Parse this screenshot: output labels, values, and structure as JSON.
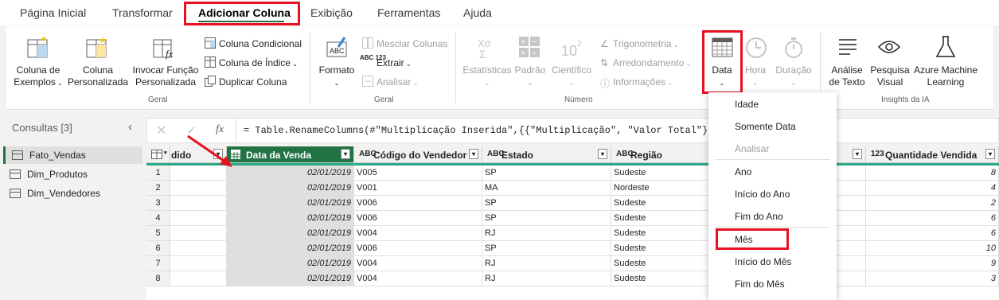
{
  "tabs": [
    "Página Inicial",
    "Transformar",
    "Adicionar Coluna",
    "Exibição",
    "Ferramentas",
    "Ajuda"
  ],
  "ribbon": {
    "geral1": {
      "coluna_exemplos": "Coluna de Exemplos",
      "coluna_personalizada": "Coluna Personalizada",
      "invocar_funcao": "Invocar Função Personalizada",
      "coluna_condicional": "Coluna Condicional",
      "coluna_indice": "Coluna de Índice",
      "duplicar_coluna": "Duplicar Coluna",
      "group_label": "Geral"
    },
    "geral2": {
      "formato": "Formato",
      "mesclar_colunas": "Mesclar Colunas",
      "extrair": "Extrair",
      "analisar": "Analisar",
      "extrair_icon_text": "ABC 123",
      "group_label": "Geral"
    },
    "numero": {
      "estatisticas": "Estatísticas",
      "padrao": "Padrão",
      "cientifico": "Científico",
      "trigonometria": "Trigonometria",
      "arredondamento": "Arredondamento",
      "informacoes": "Informações",
      "group_label": "Número"
    },
    "data_hora": {
      "data": "Data",
      "hora": "Hora",
      "duracao": "Duração"
    },
    "ia": {
      "analise_texto": "Análise de Texto",
      "pesquisa_visual": "Pesquisa Visual",
      "azure_ml": "Azure Machine Learning",
      "group_label": "Insights da IA"
    }
  },
  "queries": {
    "title": "Consultas [3]",
    "items": [
      "Fato_Vendas",
      "Dim_Produtos",
      "Dim_Vendedores"
    ]
  },
  "formula": "= Table.RenameColumns(#\"Multiplicação Inserida\",{{\"Multiplicação\", \"Valor Total\"}})",
  "grid": {
    "headers": [
      "dido",
      "Data da Venda",
      "Código do Vendedor",
      "Estado",
      "Região",
      "Quantidade Vendida"
    ],
    "header_types": [
      "",
      "",
      "ABC",
      "ABC",
      "ABC",
      "123"
    ],
    "rows": [
      {
        "n": "1",
        "data": "02/01/2019",
        "cod": "V005",
        "estado": "SP",
        "regiao": "Sudeste",
        "qtd": "8"
      },
      {
        "n": "2",
        "data": "02/01/2019",
        "cod": "V001",
        "estado": "MA",
        "regiao": "Nordeste",
        "qtd": "4"
      },
      {
        "n": "3",
        "data": "02/01/2019",
        "cod": "V006",
        "estado": "SP",
        "regiao": "Sudeste",
        "qtd": "2"
      },
      {
        "n": "4",
        "data": "02/01/2019",
        "cod": "V006",
        "estado": "SP",
        "regiao": "Sudeste",
        "qtd": "6"
      },
      {
        "n": "5",
        "data": "02/01/2019",
        "cod": "V004",
        "estado": "RJ",
        "regiao": "Sudeste",
        "qtd": "6"
      },
      {
        "n": "6",
        "data": "02/01/2019",
        "cod": "V006",
        "estado": "SP",
        "regiao": "Sudeste",
        "qtd": "10"
      },
      {
        "n": "7",
        "data": "02/01/2019",
        "cod": "V004",
        "estado": "RJ",
        "regiao": "Sudeste",
        "qtd": "9"
      },
      {
        "n": "8",
        "data": "02/01/2019",
        "cod": "V004",
        "estado": "RJ",
        "regiao": "Sudeste",
        "qtd": "3"
      }
    ]
  },
  "date_menu": {
    "items": [
      "Idade",
      "Somente Data",
      "Analisar",
      "Ano",
      "Início do Ano",
      "Fim do Ano",
      "Mês",
      "Início do Mês",
      "Fim do Mês"
    ]
  },
  "colors": {
    "accent_green": "#217346",
    "highlight_red": "#e81123",
    "teal_line": "#2ba889"
  }
}
